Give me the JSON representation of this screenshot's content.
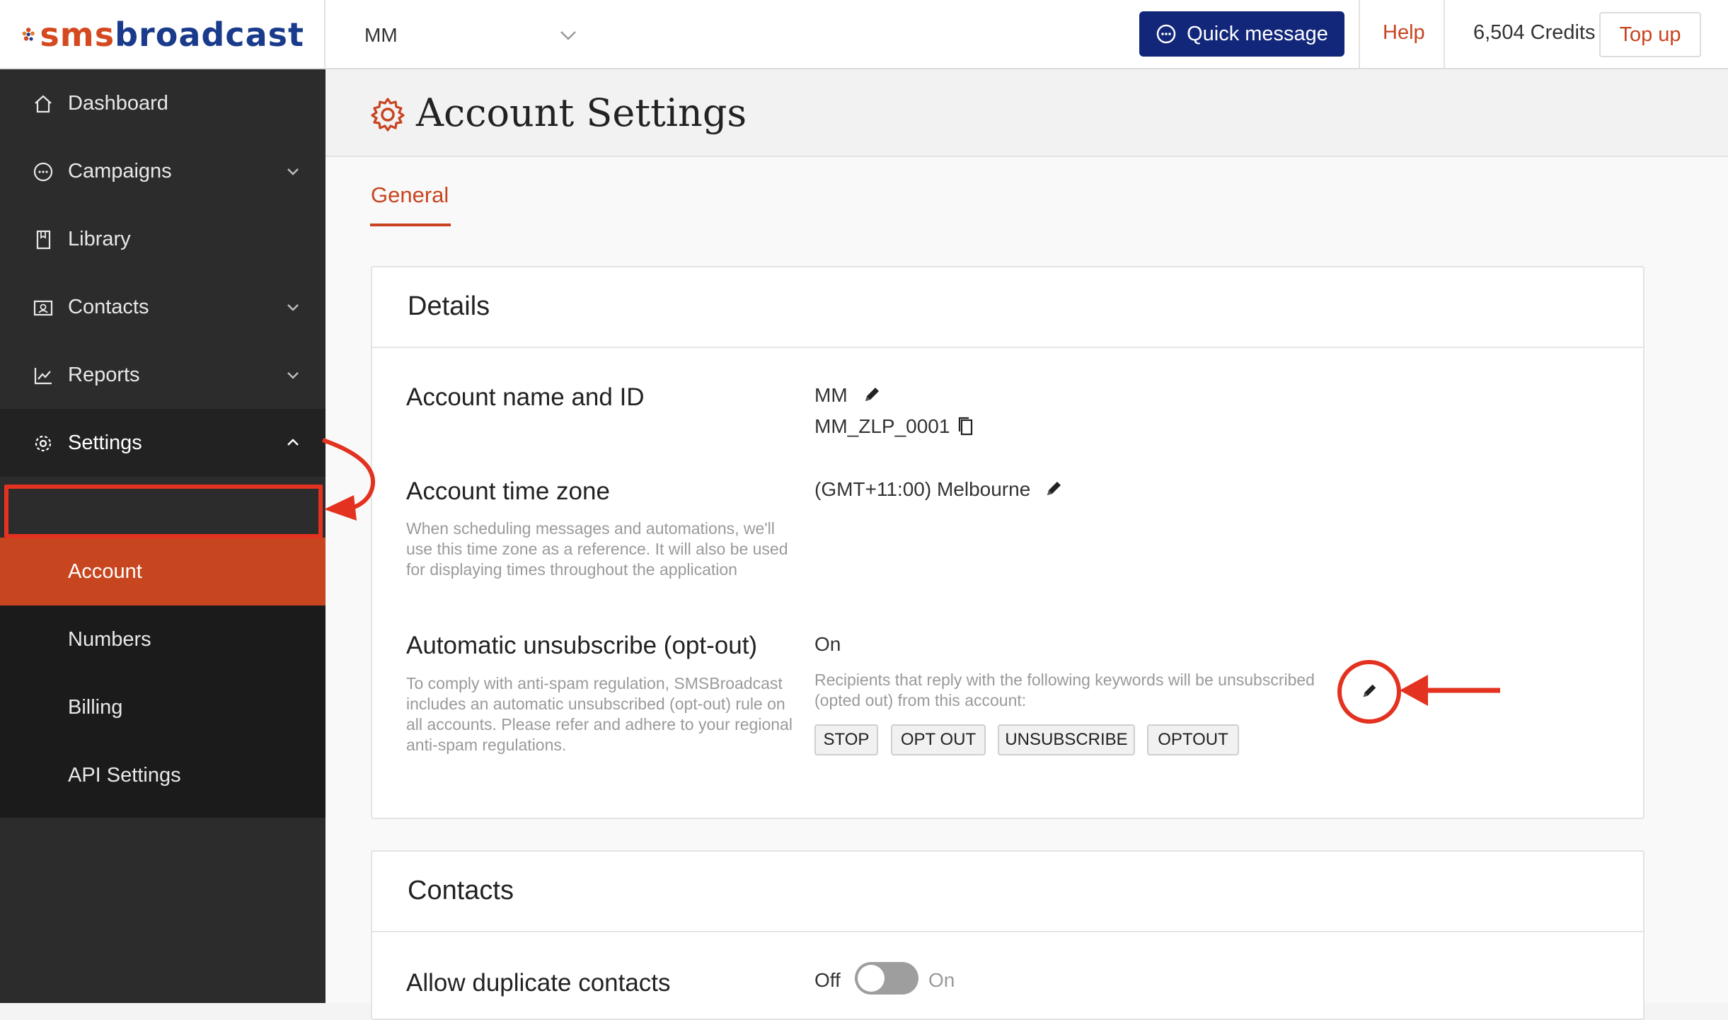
{
  "brand": {
    "logo_part1": "sms",
    "logo_part2": "broadcast",
    "primary": "#1a3b8b",
    "accent": "#d4491f"
  },
  "topbar": {
    "account_selector": {
      "value": "MM"
    },
    "quick_message_label": "Quick message",
    "help_label": "Help",
    "credits_text": "6,504 Credits",
    "topup_label": "Top up"
  },
  "sidebar": {
    "items": [
      {
        "label": "Dashboard",
        "icon": "home-icon",
        "expandable": false
      },
      {
        "label": "Campaigns",
        "icon": "chat-bubble-icon",
        "expandable": true
      },
      {
        "label": "Library",
        "icon": "book-icon",
        "expandable": false
      },
      {
        "label": "Contacts",
        "icon": "contact-card-icon",
        "expandable": true
      },
      {
        "label": "Reports",
        "icon": "chart-line-icon",
        "expandable": true
      },
      {
        "label": "Settings",
        "icon": "gear-icon",
        "expandable": true,
        "expanded": true
      }
    ],
    "settings_sub": [
      {
        "label": "Account",
        "active": true
      },
      {
        "label": "Numbers"
      },
      {
        "label": "Billing"
      },
      {
        "label": "API Settings"
      }
    ]
  },
  "page": {
    "title": "Account Settings",
    "tabs": [
      {
        "label": "General",
        "active": true
      }
    ]
  },
  "details": {
    "title": "Details",
    "account_name": {
      "label": "Account name and ID",
      "name": "MM",
      "id": "MM_ZLP_0001"
    },
    "time_zone": {
      "label": "Account time zone",
      "description": "When scheduling messages and automations, we'll use this time zone as a reference. It will also be used for displaying times throughout the application",
      "value": "(GMT+11:00) Melbourne"
    },
    "opt_out": {
      "label": "Automatic unsubscribe (opt-out)",
      "description": "To comply with anti-spam regulation, SMSBroadcast includes an automatic unsubscribed (opt-out) rule on all accounts. Please refer and adhere to your regional anti-spam regulations.",
      "status": "On",
      "info": "Recipients that reply with the following keywords will be unsubscribed (opted out) from this account:",
      "keywords": [
        "STOP",
        "OPT OUT",
        "UNSUBSCRIBE",
        "OPTOUT"
      ]
    }
  },
  "contacts": {
    "title": "Contacts",
    "allow_duplicates": {
      "label": "Allow duplicate contacts",
      "off_label": "Off",
      "on_label": "On",
      "enabled": false
    }
  },
  "annotations": {
    "highlight_color": "#e3321f"
  }
}
